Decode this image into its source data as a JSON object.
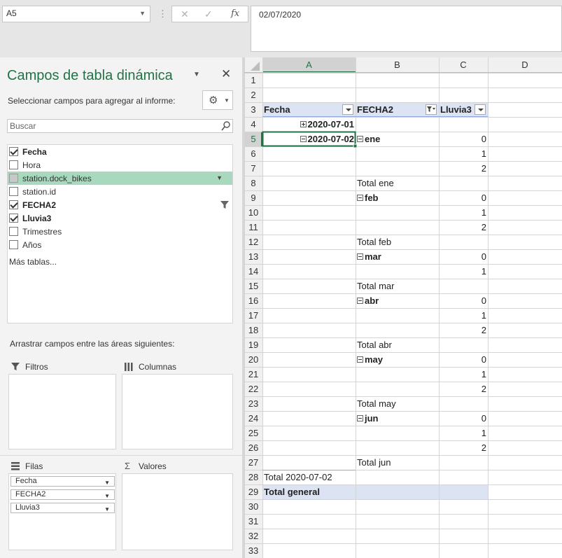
{
  "namebox": {
    "value": "A5"
  },
  "formula": {
    "value": "02/07/2020"
  },
  "pane": {
    "title": "Campos de tabla dinámica",
    "subtitle": "Seleccionar campos para agregar al informe:",
    "search_placeholder": "Buscar",
    "fields": [
      {
        "label": "Fecha",
        "checked": true,
        "bold": true
      },
      {
        "label": "Hora",
        "checked": false,
        "bold": false
      },
      {
        "label": "station.dock_bikes",
        "checked": false,
        "bold": false,
        "selected": true
      },
      {
        "label": "station.id",
        "checked": false,
        "bold": false
      },
      {
        "label": "FECHA2",
        "checked": true,
        "bold": true,
        "filtered": true
      },
      {
        "label": "Lluvia3",
        "checked": true,
        "bold": true
      },
      {
        "label": "Trimestres",
        "checked": false,
        "bold": false
      },
      {
        "label": "Años",
        "checked": false,
        "bold": false
      }
    ],
    "more_tables": "Más tablas...",
    "drag_hint": "Arrastrar campos entre las áreas siguientes:",
    "areas": {
      "filters": "Filtros",
      "columns": "Columnas",
      "rows": "Filas",
      "values": "Valores"
    },
    "row_fields": [
      "Fecha",
      "FECHA2",
      "Lluvia3"
    ]
  },
  "sheet": {
    "columns": [
      "A",
      "B",
      "C",
      "D"
    ],
    "active_cell": "A5",
    "rows": [
      {
        "n": "1"
      },
      {
        "n": "2"
      },
      {
        "n": "3",
        "a": "Fecha",
        "b": "FECHA2",
        "c": "Lluvia3",
        "header": true
      },
      {
        "n": "4",
        "a": "2020-07-01",
        "a_toggle": "plus",
        "a_bold": true,
        "a_right": true
      },
      {
        "n": "5",
        "a": "2020-07-02",
        "a_toggle": "minus",
        "a_bold": true,
        "a_right": true,
        "b": "ene",
        "b_toggle": "minus",
        "b_bold": true,
        "c": "0"
      },
      {
        "n": "6",
        "c": "1"
      },
      {
        "n": "7",
        "c": "2"
      },
      {
        "n": "8",
        "b": "Total ene"
      },
      {
        "n": "9",
        "b": "feb",
        "b_toggle": "minus",
        "b_bold": true,
        "c": "0"
      },
      {
        "n": "10",
        "c": "1"
      },
      {
        "n": "11",
        "c": "2"
      },
      {
        "n": "12",
        "b": "Total feb"
      },
      {
        "n": "13",
        "b": "mar",
        "b_toggle": "minus",
        "b_bold": true,
        "c": "0"
      },
      {
        "n": "14",
        "c": "1"
      },
      {
        "n": "15",
        "b": "Total mar"
      },
      {
        "n": "16",
        "b": "abr",
        "b_toggle": "minus",
        "b_bold": true,
        "c": "0"
      },
      {
        "n": "17",
        "c": "1"
      },
      {
        "n": "18",
        "c": "2"
      },
      {
        "n": "19",
        "b": "Total abr"
      },
      {
        "n": "20",
        "b": "may",
        "b_toggle": "minus",
        "b_bold": true,
        "c": "0"
      },
      {
        "n": "21",
        "c": "1"
      },
      {
        "n": "22",
        "c": "2"
      },
      {
        "n": "23",
        "b": "Total may"
      },
      {
        "n": "24",
        "b": "jun",
        "b_toggle": "minus",
        "b_bold": true,
        "c": "0"
      },
      {
        "n": "25",
        "c": "1"
      },
      {
        "n": "26",
        "c": "2"
      },
      {
        "n": "27",
        "b": "Total jun"
      },
      {
        "n": "28",
        "a": "Total 2020-07-02"
      },
      {
        "n": "29",
        "a": "Total general",
        "a_bold": true,
        "total": true
      },
      {
        "n": "30"
      },
      {
        "n": "31"
      },
      {
        "n": "32"
      },
      {
        "n": "33"
      }
    ]
  },
  "colors": {
    "accent": "#217346",
    "pivot_header_fill": "#dce3f2",
    "selected_field": "#a8d8be"
  }
}
